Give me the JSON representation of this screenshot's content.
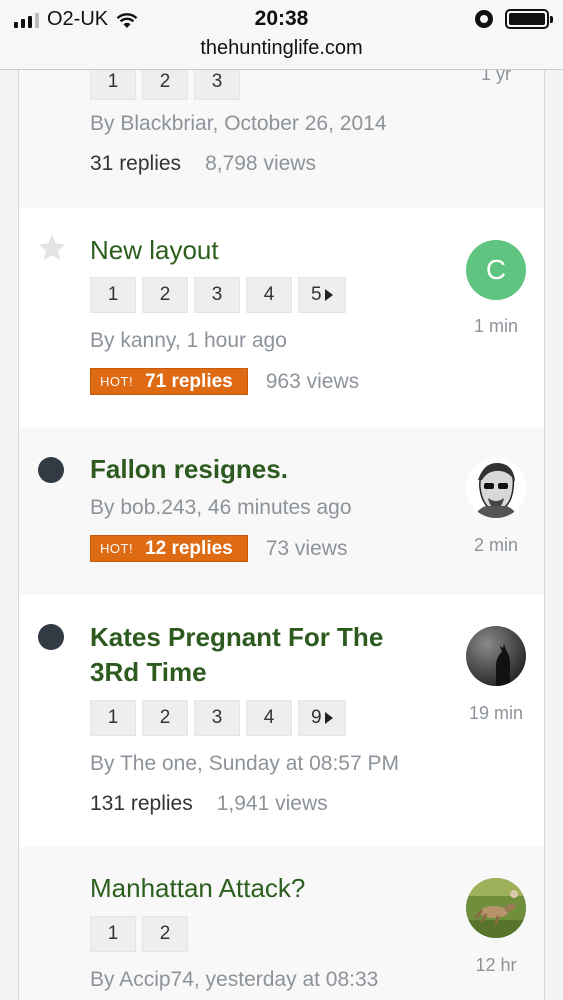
{
  "status_bar": {
    "carrier": "O2-UK",
    "time": "20:38",
    "url": "thehuntinglife.com"
  },
  "threads": [
    {
      "title": "",
      "pages": [
        "1",
        "2",
        "3"
      ],
      "byline": "By Blackbriar, October 26, 2014",
      "replies": "31 replies",
      "views": "8,798 views",
      "last": "1 yr"
    },
    {
      "title": "New layout",
      "pages": [
        "1",
        "2",
        "3",
        "4",
        "5"
      ],
      "byline": "By kanny, 1 hour ago",
      "hot_label": "HOT!",
      "replies": "71 replies",
      "views": "963 views",
      "avatar_letter": "C",
      "last": "1 min"
    },
    {
      "title": "Fallon resignes.",
      "byline": "By bob.243, 46 minutes ago",
      "hot_label": "HOT!",
      "replies": "12 replies",
      "views": "73 views",
      "last": "2 min"
    },
    {
      "title": "Kates Pregnant For The 3Rd Time",
      "pages": [
        "1",
        "2",
        "3",
        "4",
        "9"
      ],
      "byline": "By The one, Sunday at 08:57 PM",
      "replies": "131 replies",
      "views": "1,941 views",
      "last": "19 min"
    },
    {
      "title": "Manhattan Attack?",
      "pages": [
        "1",
        "2"
      ],
      "byline": "By Accip74, yesterday at 08:33",
      "last": "12 hr"
    }
  ],
  "colors": {
    "title_green": "#2c5f1d",
    "hot_orange": "#de6a14",
    "avatar_green": "#5ec480",
    "unread_dot": "#323a44"
  }
}
